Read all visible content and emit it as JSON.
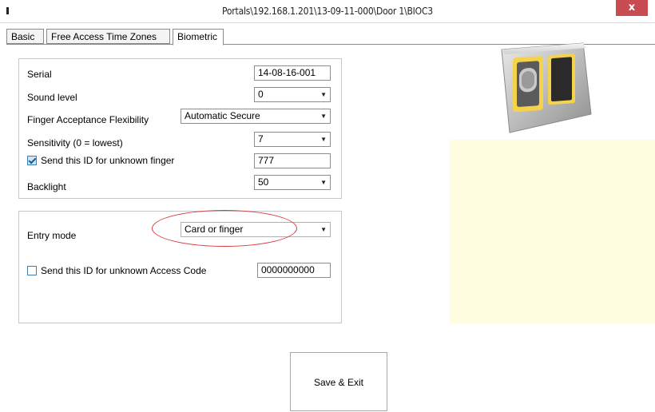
{
  "window": {
    "title": "Portals\\192.168.1.201\\13-09-11-000\\Door 1\\BIOC3",
    "close_label": "x"
  },
  "tabs": [
    {
      "label": "Basic"
    },
    {
      "label": "Free Access Time Zones"
    },
    {
      "label": "Biometric"
    }
  ],
  "biometric": {
    "serial": {
      "label": "Serial",
      "value": "14-08-16-001"
    },
    "sound_level": {
      "label": "Sound level",
      "value": "0"
    },
    "finger_flex": {
      "label": "Finger Acceptance Flexibility",
      "value": "Automatic Secure"
    },
    "sensitivity": {
      "label": "Sensitivity (0 = lowest)",
      "value": "7"
    },
    "unknown_finger": {
      "label": "Send this ID for unknown finger",
      "value": "777",
      "checked": true
    },
    "backlight": {
      "label": "Backlight",
      "value": "50"
    }
  },
  "entry": {
    "mode": {
      "label": "Entry mode",
      "value": "Card or finger"
    },
    "unknown_code": {
      "label": "Send this ID for unknown Access Code",
      "value": "0000000000",
      "checked": false
    }
  },
  "actions": {
    "save_exit": "Save & Exit"
  },
  "colors": {
    "highlight_oval": "#d83b3b",
    "preview_area": "#fefde0",
    "close_button": "#c74b50"
  }
}
